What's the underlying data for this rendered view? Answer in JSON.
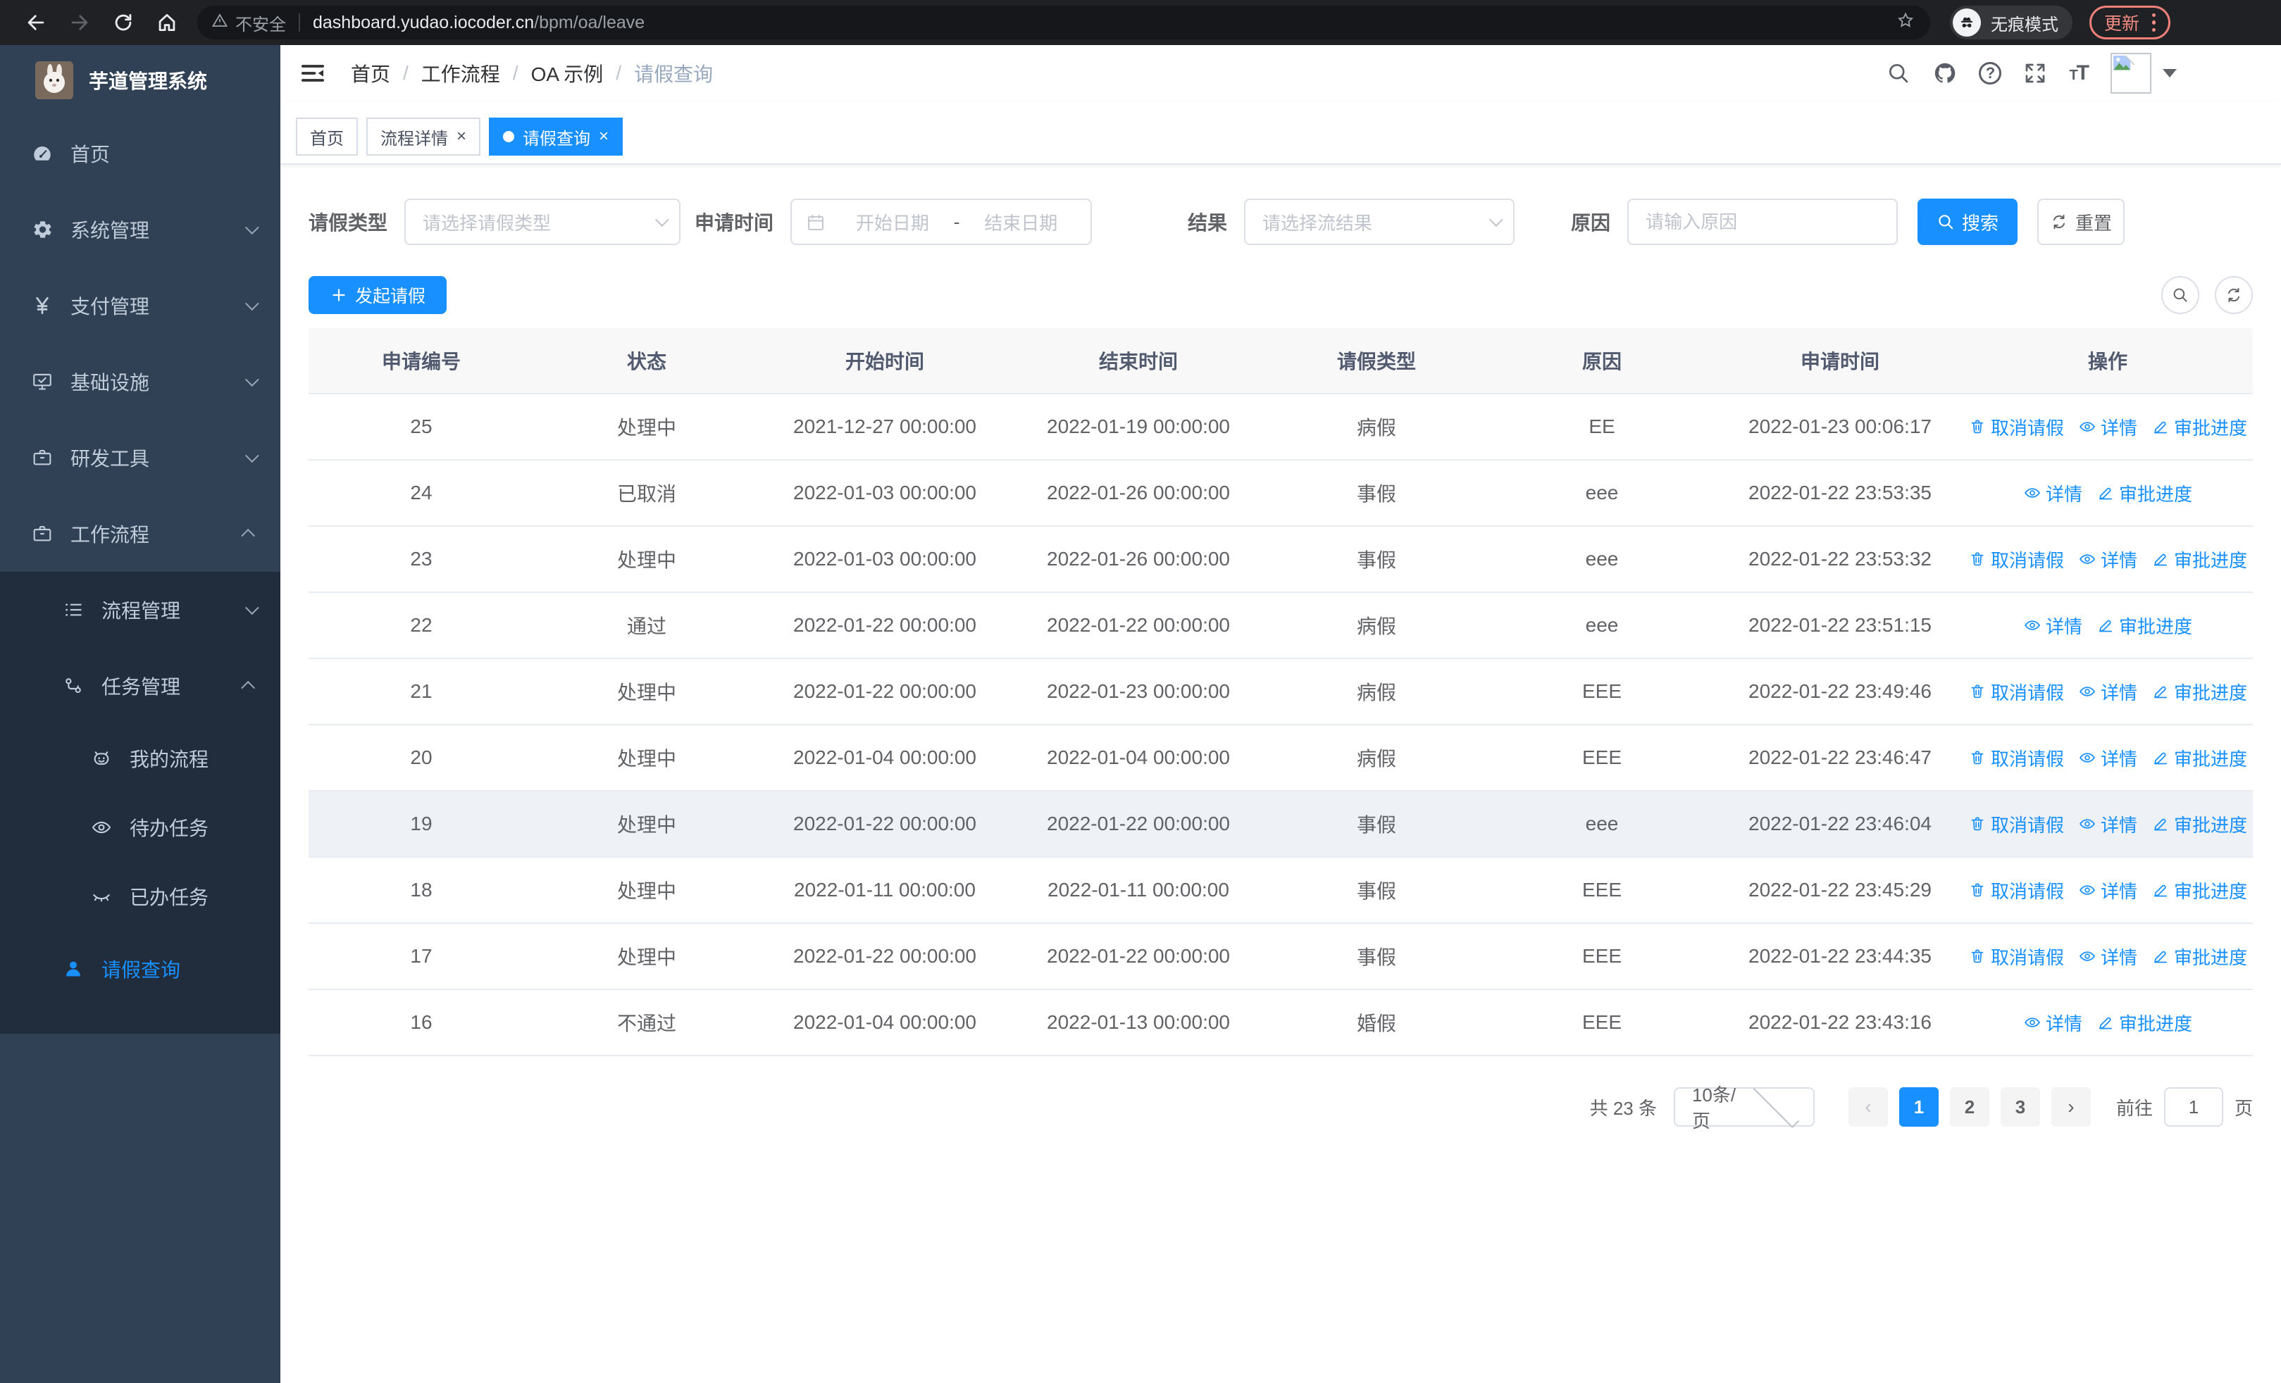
{
  "colors": {
    "primary": "#1890ff",
    "sidebar_bg": "#304156",
    "submenu_bg": "#212d3d"
  },
  "browser": {
    "security_label": "不安全",
    "url_host": "dashboard.yudao.iocoder.cn",
    "url_path": "/bpm/oa/leave",
    "incognito_label": "无痕模式",
    "update_label": "更新"
  },
  "sidebar": {
    "title": "芋道管理系统",
    "items": [
      {
        "label": "首页"
      },
      {
        "label": "系统管理"
      },
      {
        "label": "支付管理"
      },
      {
        "label": "基础设施"
      },
      {
        "label": "研发工具"
      },
      {
        "label": "工作流程"
      },
      {
        "label": "流程管理"
      },
      {
        "label": "任务管理"
      },
      {
        "label": "我的流程"
      },
      {
        "label": "待办任务"
      },
      {
        "label": "已办任务"
      },
      {
        "label": "请假查询"
      }
    ]
  },
  "navbar": {
    "breadcrumb": [
      {
        "label": "首页"
      },
      {
        "label": "工作流程"
      },
      {
        "label": "OA 示例"
      },
      {
        "label": "请假查询"
      }
    ]
  },
  "tabs": [
    {
      "label": "首页"
    },
    {
      "label": "流程详情"
    },
    {
      "label": "请假查询"
    }
  ],
  "filters": {
    "leave_type_label": "请假类型",
    "leave_type_placeholder": "请选择请假类型",
    "apply_time_label": "申请时间",
    "start_date_placeholder": "开始日期",
    "range_separator": "-",
    "end_date_placeholder": "结束日期",
    "result_label": "结果",
    "result_placeholder": "请选择流结果",
    "reason_label": "原因",
    "reason_placeholder": "请输入原因",
    "search_label": "搜索",
    "reset_label": "重置"
  },
  "toolbar": {
    "create_label": "发起请假"
  },
  "table": {
    "columns": [
      "申请编号",
      "状态",
      "开始时间",
      "结束时间",
      "请假类型",
      "原因",
      "申请时间",
      "操作"
    ],
    "action_labels": {
      "cancel": "取消请假",
      "detail": "详情",
      "progress": "审批进度"
    },
    "rows": [
      {
        "id": "25",
        "status": "处理中",
        "start_time": "2021-12-27 00:00:00",
        "end_time": "2022-01-19 00:00:00",
        "leave_type": "病假",
        "reason": "EE",
        "apply_time": "2022-01-23 00:06:17",
        "actions": [
          "cancel",
          "detail",
          "progress"
        ],
        "highlighted": false
      },
      {
        "id": "24",
        "status": "已取消",
        "start_time": "2022-01-03 00:00:00",
        "end_time": "2022-01-26 00:00:00",
        "leave_type": "事假",
        "reason": "eee",
        "apply_time": "2022-01-22 23:53:35",
        "actions": [
          "detail",
          "progress"
        ],
        "highlighted": false
      },
      {
        "id": "23",
        "status": "处理中",
        "start_time": "2022-01-03 00:00:00",
        "end_time": "2022-01-26 00:00:00",
        "leave_type": "事假",
        "reason": "eee",
        "apply_time": "2022-01-22 23:53:32",
        "actions": [
          "cancel",
          "detail",
          "progress"
        ],
        "highlighted": false
      },
      {
        "id": "22",
        "status": "通过",
        "start_time": "2022-01-22 00:00:00",
        "end_time": "2022-01-22 00:00:00",
        "leave_type": "病假",
        "reason": "eee",
        "apply_time": "2022-01-22 23:51:15",
        "actions": [
          "detail",
          "progress"
        ],
        "highlighted": false
      },
      {
        "id": "21",
        "status": "处理中",
        "start_time": "2022-01-22 00:00:00",
        "end_time": "2022-01-23 00:00:00",
        "leave_type": "病假",
        "reason": "EEE",
        "apply_time": "2022-01-22 23:49:46",
        "actions": [
          "cancel",
          "detail",
          "progress"
        ],
        "highlighted": false
      },
      {
        "id": "20",
        "status": "处理中",
        "start_time": "2022-01-04 00:00:00",
        "end_time": "2022-01-04 00:00:00",
        "leave_type": "病假",
        "reason": "EEE",
        "apply_time": "2022-01-22 23:46:47",
        "actions": [
          "cancel",
          "detail",
          "progress"
        ],
        "highlighted": false
      },
      {
        "id": "19",
        "status": "处理中",
        "start_time": "2022-01-22 00:00:00",
        "end_time": "2022-01-22 00:00:00",
        "leave_type": "事假",
        "reason": "eee",
        "apply_time": "2022-01-22 23:46:04",
        "actions": [
          "cancel",
          "detail",
          "progress"
        ],
        "highlighted": true
      },
      {
        "id": "18",
        "status": "处理中",
        "start_time": "2022-01-11 00:00:00",
        "end_time": "2022-01-11 00:00:00",
        "leave_type": "事假",
        "reason": "EEE",
        "apply_time": "2022-01-22 23:45:29",
        "actions": [
          "cancel",
          "detail",
          "progress"
        ],
        "highlighted": false
      },
      {
        "id": "17",
        "status": "处理中",
        "start_time": "2022-01-22 00:00:00",
        "end_time": "2022-01-22 00:00:00",
        "leave_type": "事假",
        "reason": "EEE",
        "apply_time": "2022-01-22 23:44:35",
        "actions": [
          "cancel",
          "detail",
          "progress"
        ],
        "highlighted": false
      },
      {
        "id": "16",
        "status": "不通过",
        "start_time": "2022-01-04 00:00:00",
        "end_time": "2022-01-13 00:00:00",
        "leave_type": "婚假",
        "reason": "EEE",
        "apply_time": "2022-01-22 23:43:16",
        "actions": [
          "detail",
          "progress"
        ],
        "highlighted": false
      }
    ]
  },
  "pagination": {
    "total_label": "共 23 条",
    "page_size_label": "10条/页",
    "pages": [
      "1",
      "2",
      "3"
    ],
    "active_page": "1",
    "prev_label": "‹",
    "next_label": "›",
    "goto_label": "前往",
    "goto_value": "1",
    "page_unit_label": "页"
  }
}
